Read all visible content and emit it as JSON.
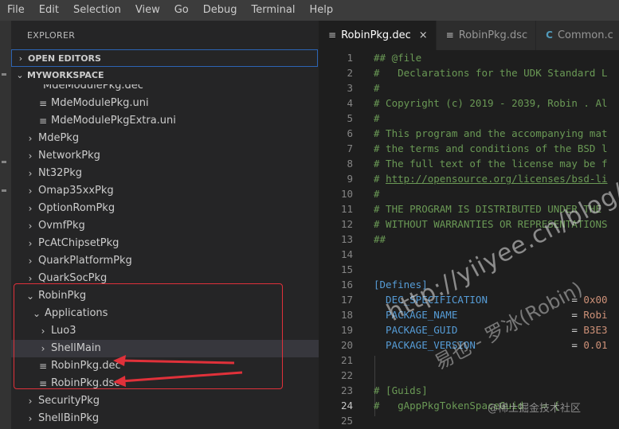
{
  "menu": [
    "File",
    "Edit",
    "Selection",
    "View",
    "Go",
    "Debug",
    "Terminal",
    "Help"
  ],
  "sidebar": {
    "title": "EXPLORER",
    "open_editors": "OPEN EDITORS",
    "workspace": "MYWORKSPACE",
    "partial_item": "MdeModulePkg.dec",
    "items": [
      {
        "label": "MdeModulePkg.uni",
        "type": "file",
        "depth": 1
      },
      {
        "label": "MdeModulePkgExtra.uni",
        "type": "file",
        "depth": 1
      },
      {
        "label": "MdePkg",
        "type": "folder",
        "depth": 0,
        "open": false
      },
      {
        "label": "NetworkPkg",
        "type": "folder",
        "depth": 0,
        "open": false
      },
      {
        "label": "Nt32Pkg",
        "type": "folder",
        "depth": 0,
        "open": false
      },
      {
        "label": "Omap35xxPkg",
        "type": "folder",
        "depth": 0,
        "open": false
      },
      {
        "label": "OptionRomPkg",
        "type": "folder",
        "depth": 0,
        "open": false
      },
      {
        "label": "OvmfPkg",
        "type": "folder",
        "depth": 0,
        "open": false
      },
      {
        "label": "PcAtChipsetPkg",
        "type": "folder",
        "depth": 0,
        "open": false
      },
      {
        "label": "QuarkPlatformPkg",
        "type": "folder",
        "depth": 0,
        "open": false
      },
      {
        "label": "QuarkSocPkg",
        "type": "folder",
        "depth": 0,
        "open": false
      },
      {
        "label": "RobinPkg",
        "type": "folder",
        "depth": 0,
        "open": true
      },
      {
        "label": "Applications",
        "type": "folder",
        "depth": 1,
        "open": true
      },
      {
        "label": "Luo3",
        "type": "folder",
        "depth": 2,
        "open": false
      },
      {
        "label": "ShellMain",
        "type": "folder",
        "depth": 2,
        "open": false,
        "selected": true
      },
      {
        "label": "RobinPkg.dec",
        "type": "file",
        "depth": 1
      },
      {
        "label": "RobinPkg.dsc",
        "type": "file",
        "depth": 1
      },
      {
        "label": "SecurityPkg",
        "type": "folder",
        "depth": 0,
        "open": false
      },
      {
        "label": "ShellBinPkg",
        "type": "folder",
        "depth": 0,
        "open": false
      }
    ]
  },
  "tabs": [
    {
      "label": "RobinPkg.dec",
      "active": true,
      "icon": "≡",
      "close": "×"
    },
    {
      "label": "RobinPkg.dsc",
      "active": false,
      "icon": "≡"
    },
    {
      "label": "Common.c",
      "active": false,
      "icon": "C"
    }
  ],
  "editor": {
    "current_line": 24,
    "lines": [
      [
        {
          "t": "## @file",
          "c": "com"
        }
      ],
      [
        {
          "t": "#   Declarations for the UDK Standard L",
          "c": "com"
        }
      ],
      [
        {
          "t": "#",
          "c": "com"
        }
      ],
      [
        {
          "t": "# Copyright (c) 2019 - 2039, Robin . Al",
          "c": "com"
        }
      ],
      [
        {
          "t": "#",
          "c": "com"
        }
      ],
      [
        {
          "t": "# This program and the accompanying mat",
          "c": "com"
        }
      ],
      [
        {
          "t": "# the terms and conditions of the BSD l",
          "c": "com"
        }
      ],
      [
        {
          "t": "# The full text of the license may be f",
          "c": "com"
        }
      ],
      [
        {
          "t": "# ",
          "c": "com"
        },
        {
          "t": "http://opensource.org/licenses/bsd-li",
          "c": "link"
        }
      ],
      [
        {
          "t": "#",
          "c": "com"
        }
      ],
      [
        {
          "t": "# THE PROGRAM IS DISTRIBUTED UNDER THE",
          "c": "com"
        }
      ],
      [
        {
          "t": "# WITHOUT WARRANTIES OR REPRESENTATIONS",
          "c": "com"
        }
      ],
      [
        {
          "t": "##",
          "c": "com"
        }
      ],
      [],
      [],
      [
        {
          "t": "[Defines]",
          "c": "sec"
        }
      ],
      [
        {
          "t": "  DEC_SPECIFICATION",
          "c": "key"
        },
        {
          "t": "              = ",
          "c": "eq"
        },
        {
          "t": "0x00",
          "c": "val"
        }
      ],
      [
        {
          "t": "  PACKAGE_NAME",
          "c": "key"
        },
        {
          "t": "                   = ",
          "c": "eq"
        },
        {
          "t": "Robi",
          "c": "val"
        }
      ],
      [
        {
          "t": "  PACKAGE_GUID",
          "c": "key"
        },
        {
          "t": "                   = ",
          "c": "eq"
        },
        {
          "t": "B3E3",
          "c": "val"
        }
      ],
      [
        {
          "t": "  PACKAGE_VERSION",
          "c": "key"
        },
        {
          "t": "                = ",
          "c": "eq"
        },
        {
          "t": "0.01",
          "c": "val"
        }
      ],
      [],
      [],
      [
        {
          "t": "# [Guids]",
          "c": "com"
        }
      ],
      [
        {
          "t": "#   gAppPkgTokenSpaceGuid   = { ",
          "c": "com"
        }
      ],
      []
    ]
  },
  "watermark": {
    "line1": "http://yiiyee.cn/blog/",
    "line2": "易也 - 罗冰(Robin)",
    "footer": "@稀土掘金技术社区"
  }
}
